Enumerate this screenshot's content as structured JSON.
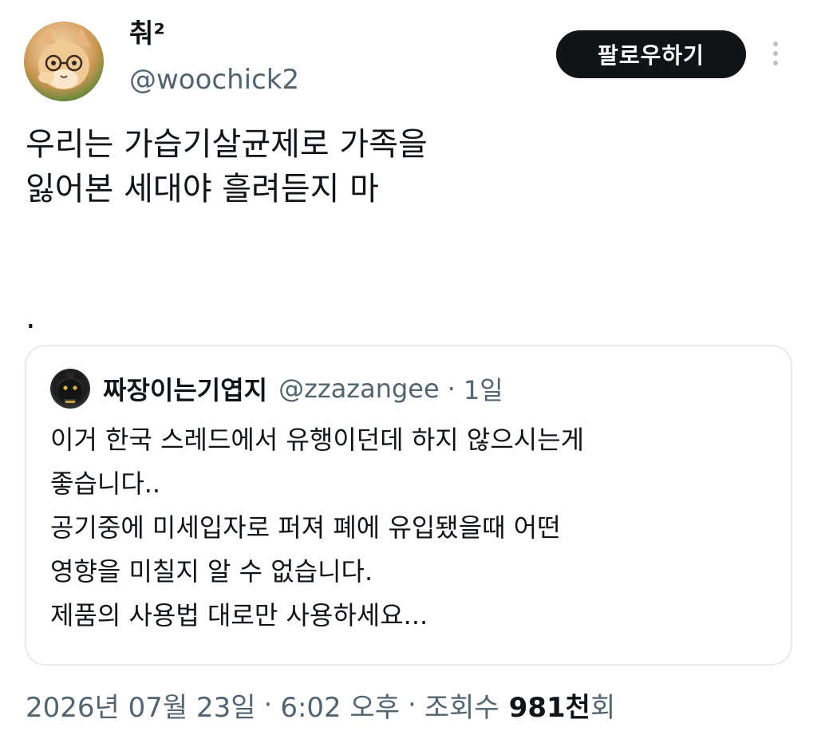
{
  "author": {
    "display_name": "춰²",
    "handle": "@woochick2",
    "avatar_icon": "cat-with-glasses-avatar"
  },
  "actions": {
    "follow_label": "팔로우하기",
    "more_icon": "more-vertical-icon"
  },
  "tweet": {
    "lines": [
      "우리는 가습기살균제로 가족을",
      "잃어본 세대야 흘려듣지 마"
    ],
    "trailing": "."
  },
  "quote": {
    "display_name": "짜장이는기엽지",
    "handle": "@zzazangee",
    "separator": "·",
    "time": "1일",
    "avatar_icon": "black-cat-avatar",
    "lines": [
      "이거 한국 스레드에서 유행이던데 하지 않으시는게",
      "좋습니다..",
      "공기중에 미세입자로 퍼져 폐에 유입됐을때 어떤",
      "영향을 미칠지 알 수 없습니다.",
      "제품의 사용법 대로만 사용하세요..."
    ]
  },
  "meta": {
    "date": "2026년 07월 23일",
    "separator": "·",
    "time": "6:02 오후",
    "views_label": "조회수",
    "views_count": "981천",
    "views_suffix": "회"
  },
  "colors": {
    "text_primary": "#0f1419",
    "text_secondary": "#536471",
    "border": "#e6ebef",
    "button_bg": "#0f1419"
  }
}
